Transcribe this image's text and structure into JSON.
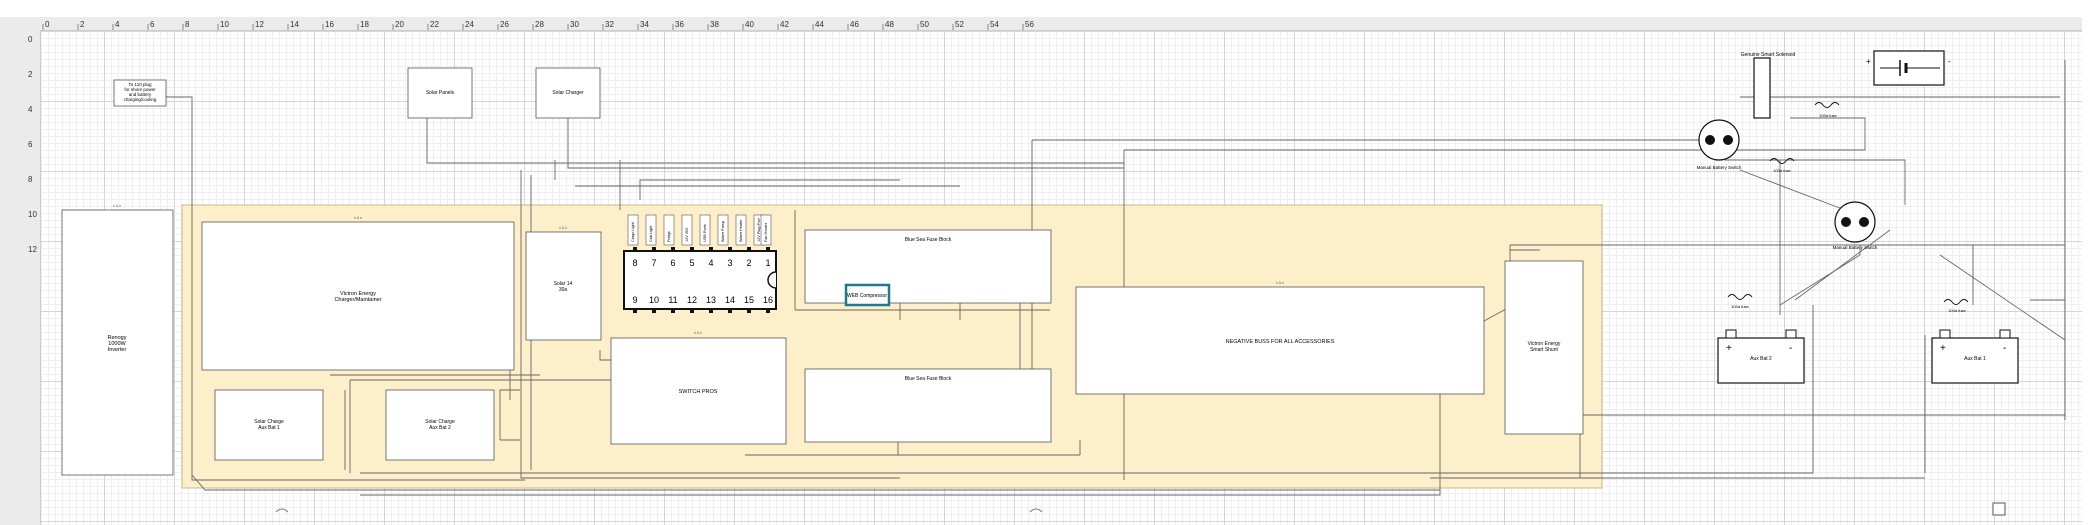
{
  "ruler": {
    "h_ticks": [
      "0",
      "2",
      "4",
      "6",
      "8",
      "10",
      "12",
      "14",
      "16",
      "18",
      "20",
      "22",
      "24",
      "26",
      "28",
      "30",
      "32",
      "34",
      "36",
      "38",
      "40",
      "42",
      "44",
      "46",
      "48",
      "50",
      "52",
      "54",
      "56"
    ],
    "v_ticks": [
      "0",
      "2",
      "4",
      "6",
      "8",
      "10",
      "12"
    ]
  },
  "diagram": {
    "shore_note": [
      "To 110 plug",
      "for shore power",
      "and battery",
      "charging/cooling"
    ],
    "solar_panels": "Solar Panels",
    "solar_charger": "Solar Charger",
    "inverter": [
      "Renogy",
      "1000W",
      "Inverter"
    ],
    "victron_charger": [
      "Victron Energy",
      "Charger/Maintainer"
    ],
    "solar_fuse": [
      "Solar 14",
      "30a"
    ],
    "relay_labels": [
      "Cargo Light",
      "Cab Light",
      "Fridge",
      "12V ISO",
      "USB Ports",
      "Water Pump",
      "Water Heater",
      "12V Plug-Port",
      "Fan Heater"
    ],
    "relay_top_pins": [
      "8",
      "7",
      "6",
      "5",
      "4",
      "3",
      "2",
      "1"
    ],
    "relay_bottom_pins": [
      "9",
      "10",
      "11",
      "12",
      "13",
      "14",
      "15",
      "16"
    ],
    "fuse_block_1": "Blue Sea Fuse Block",
    "fuse_block_2": "Blue Sea Fuse Block",
    "compressor": "WEB Compressor",
    "switch_pros": "SWITCH PROS",
    "negative_bus": "NEGATIVE BUSS FOR ALL ACCESSORIES",
    "smart_shunt": [
      "Victron Energy",
      "Smart Shunt"
    ],
    "solar_charge_1": [
      "Solar Charge",
      "Aux Bat 1"
    ],
    "solar_charge_2": [
      "Solar Charge",
      "Aux Bat 2"
    ],
    "genuine_solenoid": "Genuine Smart Solenoid",
    "fuse_label": "100a fuse",
    "manual_switch_1": "Manual Battery Switch",
    "manual_switch_2": "Manual Battery Switch",
    "aux_bat_2": "Aux Bat 2",
    "aux_bat_1": "Aux Bat 1",
    "plus": "+",
    "minus": "-",
    "wire_tag": "< 1 >"
  },
  "colors": {
    "zone_fill": "#fcefc9",
    "zone_stroke": "#c9b98a",
    "highlight": "#1e7a8c",
    "wire": "#555555"
  }
}
